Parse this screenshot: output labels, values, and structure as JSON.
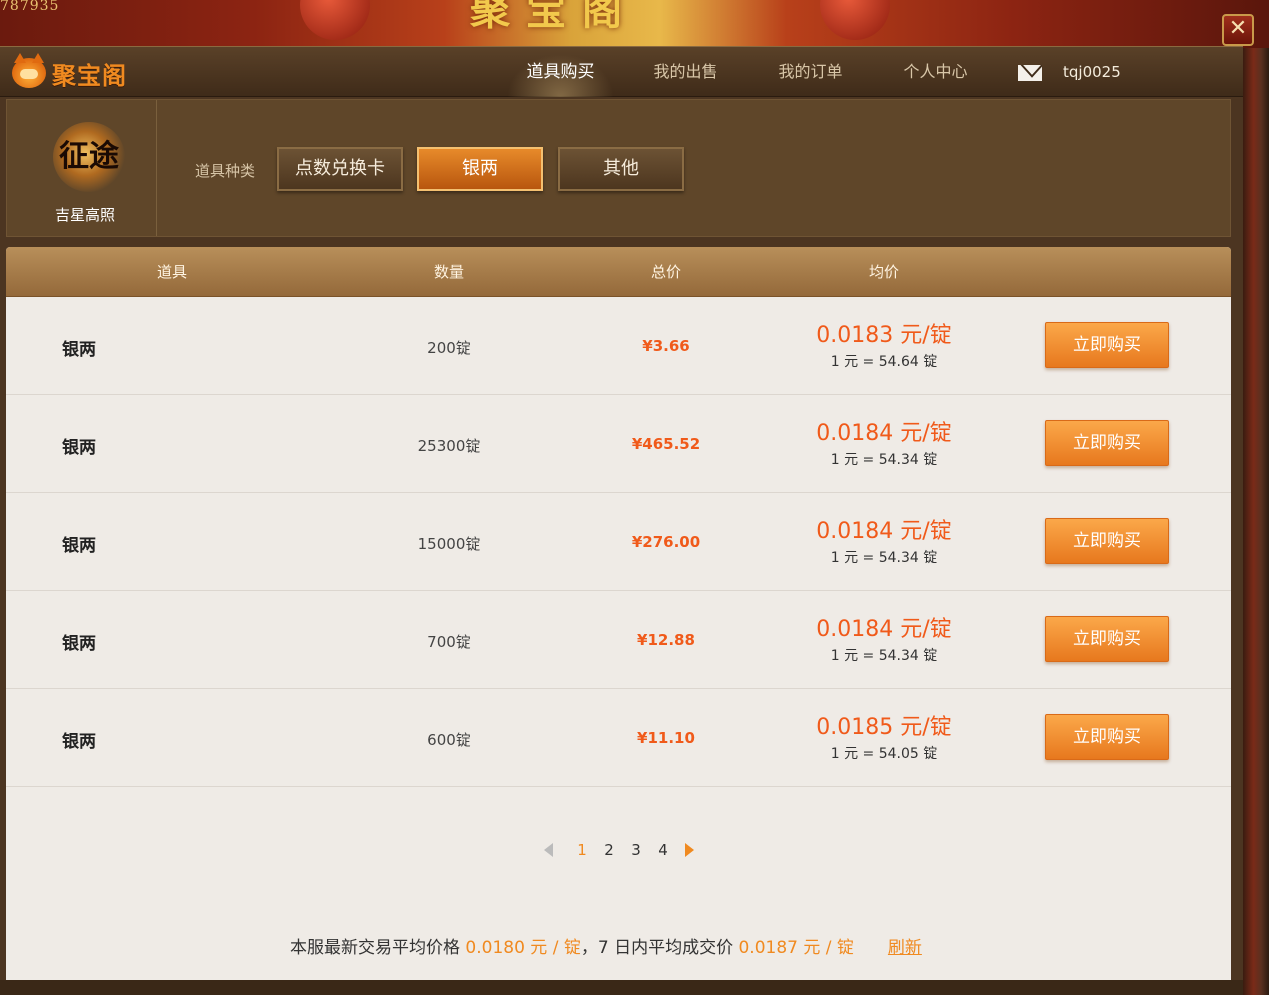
{
  "banner": {
    "fragment": "787935",
    "title": "聚宝阁"
  },
  "close_label": "✕",
  "header": {
    "logo_text": "聚宝阁",
    "nav": [
      {
        "label": "道具购买",
        "active": true
      },
      {
        "label": "我的出售",
        "active": false
      },
      {
        "label": "我的订单",
        "active": false
      },
      {
        "label": "个人中心",
        "active": false
      }
    ],
    "username": "tqj0025"
  },
  "game": {
    "logo_glyph": "征途",
    "name": "吉星高照"
  },
  "category": {
    "label": "道具种类",
    "options": [
      {
        "label": "点数兑换卡",
        "active": false
      },
      {
        "label": "银两",
        "active": true
      },
      {
        "label": "其他",
        "active": false
      }
    ]
  },
  "table": {
    "headers": [
      "道具",
      "数量",
      "总价",
      "均价"
    ],
    "rows": [
      {
        "item": "银两",
        "qty": "200锭",
        "total": "¥3.66",
        "avg": "0.0183 元/锭",
        "rate": "1 元 = 54.64 锭",
        "action": "立即购买"
      },
      {
        "item": "银两",
        "qty": "25300锭",
        "total": "¥465.52",
        "avg": "0.0184 元/锭",
        "rate": "1 元 = 54.34 锭",
        "action": "立即购买"
      },
      {
        "item": "银两",
        "qty": "15000锭",
        "total": "¥276.00",
        "avg": "0.0184 元/锭",
        "rate": "1 元 = 54.34 锭",
        "action": "立即购买"
      },
      {
        "item": "银两",
        "qty": "700锭",
        "total": "¥12.88",
        "avg": "0.0184 元/锭",
        "rate": "1 元 = 54.34 锭",
        "action": "立即购买"
      },
      {
        "item": "银两",
        "qty": "600锭",
        "total": "¥11.10",
        "avg": "0.0185 元/锭",
        "rate": "1 元 = 54.05 锭",
        "action": "立即购买"
      }
    ]
  },
  "pager": {
    "pages": [
      "1",
      "2",
      "3",
      "4"
    ],
    "current": "1"
  },
  "footer": {
    "prefix": "本服最新交易平均价格 ",
    "latest_price": "0.0180 元 / 锭",
    "middle": "，7 日内平均成交价 ",
    "week_price": "0.0187 元 / 锭",
    "refresh": "刷新"
  },
  "colors": {
    "accent": "#f08a20",
    "price": "#f05a1a",
    "button": "#e7781e",
    "header_bg": "#4c3521"
  },
  "icons": [
    "close-icon",
    "logo-icon",
    "mail-icon",
    "arrow-left-icon",
    "arrow-right-icon"
  ]
}
